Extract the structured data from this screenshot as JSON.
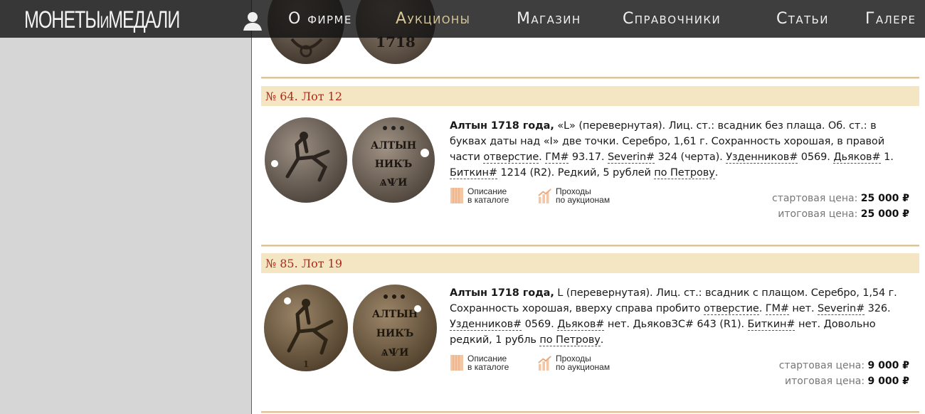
{
  "site": {
    "logo_main": "МОНЕТЫ",
    "logo_mid": "И",
    "logo_end": "МЕДАЛИ"
  },
  "nav": {
    "items": [
      {
        "label": "О фирме"
      },
      {
        "label": "Аукционы"
      },
      {
        "label": "Магазин"
      },
      {
        "label": "Справочники"
      },
      {
        "label": "Статьи"
      },
      {
        "label": "Галере"
      }
    ],
    "active": "Аукционы"
  },
  "top_coin": {
    "text": "1718"
  },
  "lots": [
    {
      "header": "№ 64. Лот 12",
      "title": "Алтын 1718 года,",
      "t1": " «L» (перевернутая). Лиц. ст.: всадник без плаща. Об. ст.: в буквах даты над «I» две точки. Серебро, 1,61 г. Сохранность хорошая, в правой части ",
      "otv": "отверстие",
      "t2": ". ",
      "gm": "ГМ#",
      "t3": " 93.17. ",
      "sev": "Severin#",
      "t4": " 324 (черта). ",
      "uzd": "Узденников#",
      "t5": " 0569. ",
      "dya": "Дьяков#",
      "t6": " 1. ",
      "bit": "Биткин#",
      "t7": " 1214 (R2). Редкий, 5 рублей ",
      "pet": "по Петрову",
      "t8": ".",
      "start_label": "стартовая цена:",
      "start_value": "25 000 ₽",
      "final_label": "итоговая цена:",
      "final_value": "25 000 ₽",
      "obverse": [
        "",
        "",
        ""
      ],
      "reverse": [
        "АЛТЫН",
        "НИКЪ",
        "ѦѰИ"
      ]
    },
    {
      "header": "№ 85. Лот 19",
      "title": "Алтын 1718 года,",
      "t1": " L (перевернутая). Лиц. ст.: всадник с плащом. Серебро, 1,54 г. Сохранность хорошая, вверху справа пробито ",
      "otv": "отверстие",
      "t2": ". ",
      "gm": "ГМ#",
      "t3": " нет. ",
      "sev": "Severin#",
      "t4": " 326. ",
      "uzd": "Узденников#",
      "t5": " 0569. ",
      "dya": "Дьяков#",
      "t6": " нет. ДьяковЗС# 643 (R1). ",
      "bit": "Биткин#",
      "t7": " нет. Довольно редкий, 1 рубль ",
      "pet": "по Петрову",
      "t8": ".",
      "start_label": "стартовая цена:",
      "start_value": "9 000 ₽",
      "final_label": "итоговая цена:",
      "final_value": "9 000 ₽",
      "obverse": [
        "",
        "",
        ""
      ],
      "reverse": [
        "АЛТЫН",
        "НИКЪ",
        "ѦѰИ"
      ]
    }
  ],
  "actions": {
    "catalog_l1": "Описание",
    "catalog_l2": "в каталоге",
    "auctions_l1": "Проходы",
    "auctions_l2": "по аукционам"
  },
  "colors": {
    "topbar": "#222222",
    "lot_bar": "#f5e6c3",
    "lot_header_text": "#b0271a",
    "sidebar": "#d6d6d6",
    "accent_divider": "#c0392b"
  },
  "icons": {
    "user": "user-icon",
    "catalog": "catalog-icon",
    "auctions": "auction-history-icon"
  }
}
